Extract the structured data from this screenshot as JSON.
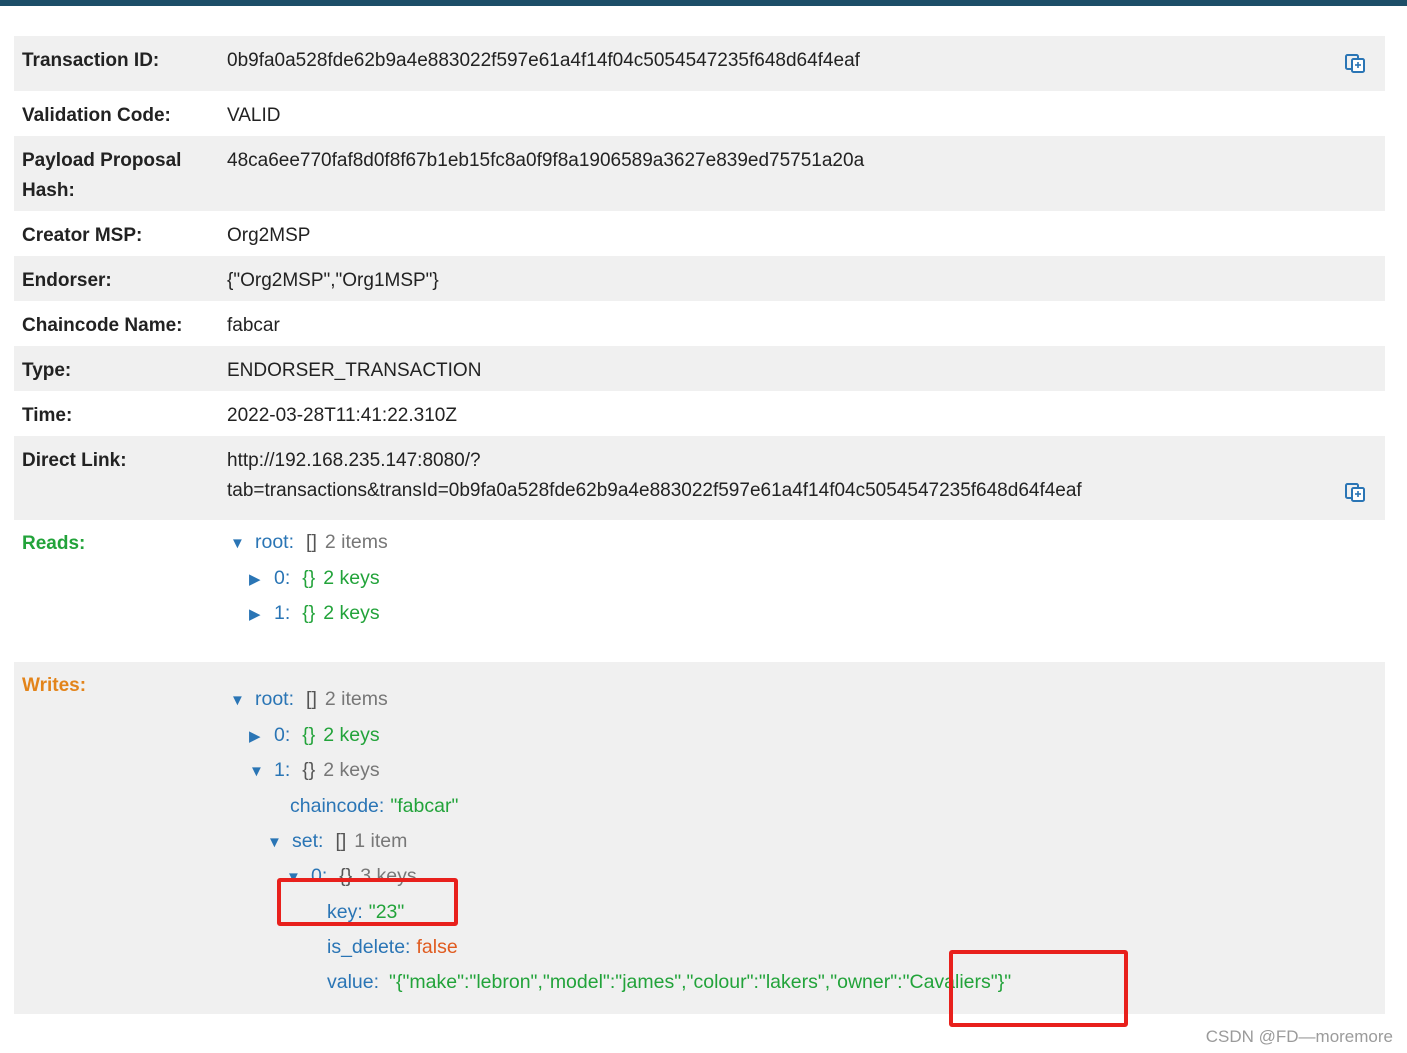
{
  "detail_rows": [
    {
      "label": "Transaction ID:",
      "value": "0b9fa0a528fde62b9a4e883022f597e61a4f14f04c5054547235f648d64f4eaf"
    },
    {
      "label": "Validation Code:",
      "value": "VALID"
    },
    {
      "label": "Payload Proposal Hash:",
      "value": "48ca6ee770faf8d0f8f67b1eb15fc8a0f9f8a1906589a3627e839ed75751a20a"
    },
    {
      "label": "Creator MSP:",
      "value": "Org2MSP"
    },
    {
      "label": "Endorser:",
      "value": "{\"Org2MSP\",\"Org1MSP\"}"
    },
    {
      "label": "Chaincode Name:",
      "value": "fabcar"
    },
    {
      "label": "Type:",
      "value": "ENDORSER_TRANSACTION"
    },
    {
      "label": "Time:",
      "value": "2022-03-28T11:41:22.310Z"
    },
    {
      "label": "Direct Link:",
      "value_line1": "http://192.168.235.147:8080/?",
      "value_line2": "tab=transactions&transId=0b9fa0a528fde62b9a4e883022f597e61a4f14f04c5054547235f648d64f4eaf"
    }
  ],
  "icons": {
    "copy": "copy-icon",
    "expanded": "triangle-down-icon",
    "collapsed": "triangle-right-icon"
  },
  "reads": {
    "label": "Reads:",
    "root_key": "root:",
    "root_brace": "[]",
    "root_count": "2 items",
    "items": [
      {
        "key": "0:",
        "brace": "{}",
        "count": "2 keys"
      },
      {
        "key": "1:",
        "brace": "{}",
        "count": "2 keys"
      }
    ]
  },
  "writes": {
    "label": "Writes:",
    "root_key": "root:",
    "root_brace": "[]",
    "root_count": "2 items",
    "item0": {
      "key": "0:",
      "brace": "{}",
      "count": "2 keys"
    },
    "item1": {
      "key": "1:",
      "brace": "{}",
      "count": "2 keys"
    },
    "chaincode_key": "chaincode:",
    "chaincode_value": "\"fabcar\"",
    "set_key": "set:",
    "set_brace": "[]",
    "set_count": "1 item",
    "set0_key": "0:",
    "set0_brace": "{}",
    "set0_count": "3 keys",
    "key_key": "key:",
    "key_value": "\"23\"",
    "is_delete_key": "is_delete:",
    "is_delete_value": "false",
    "value_key": "value:",
    "value_value": "\"{\"make\":\"lebron\",\"model\":\"james\",\"colour\":\"lakers\",\"owner\":\"Cavaliers\"}\""
  },
  "colors": {
    "topbar": "#1d4e68",
    "key": "#2a75b5",
    "string": "#22a33a",
    "boolean": "#e05b1f",
    "reads_label": "#22a33a",
    "writes_label": "#e3841a",
    "highlight": "#e8201c"
  },
  "watermark": "CSDN @FD—moremore"
}
